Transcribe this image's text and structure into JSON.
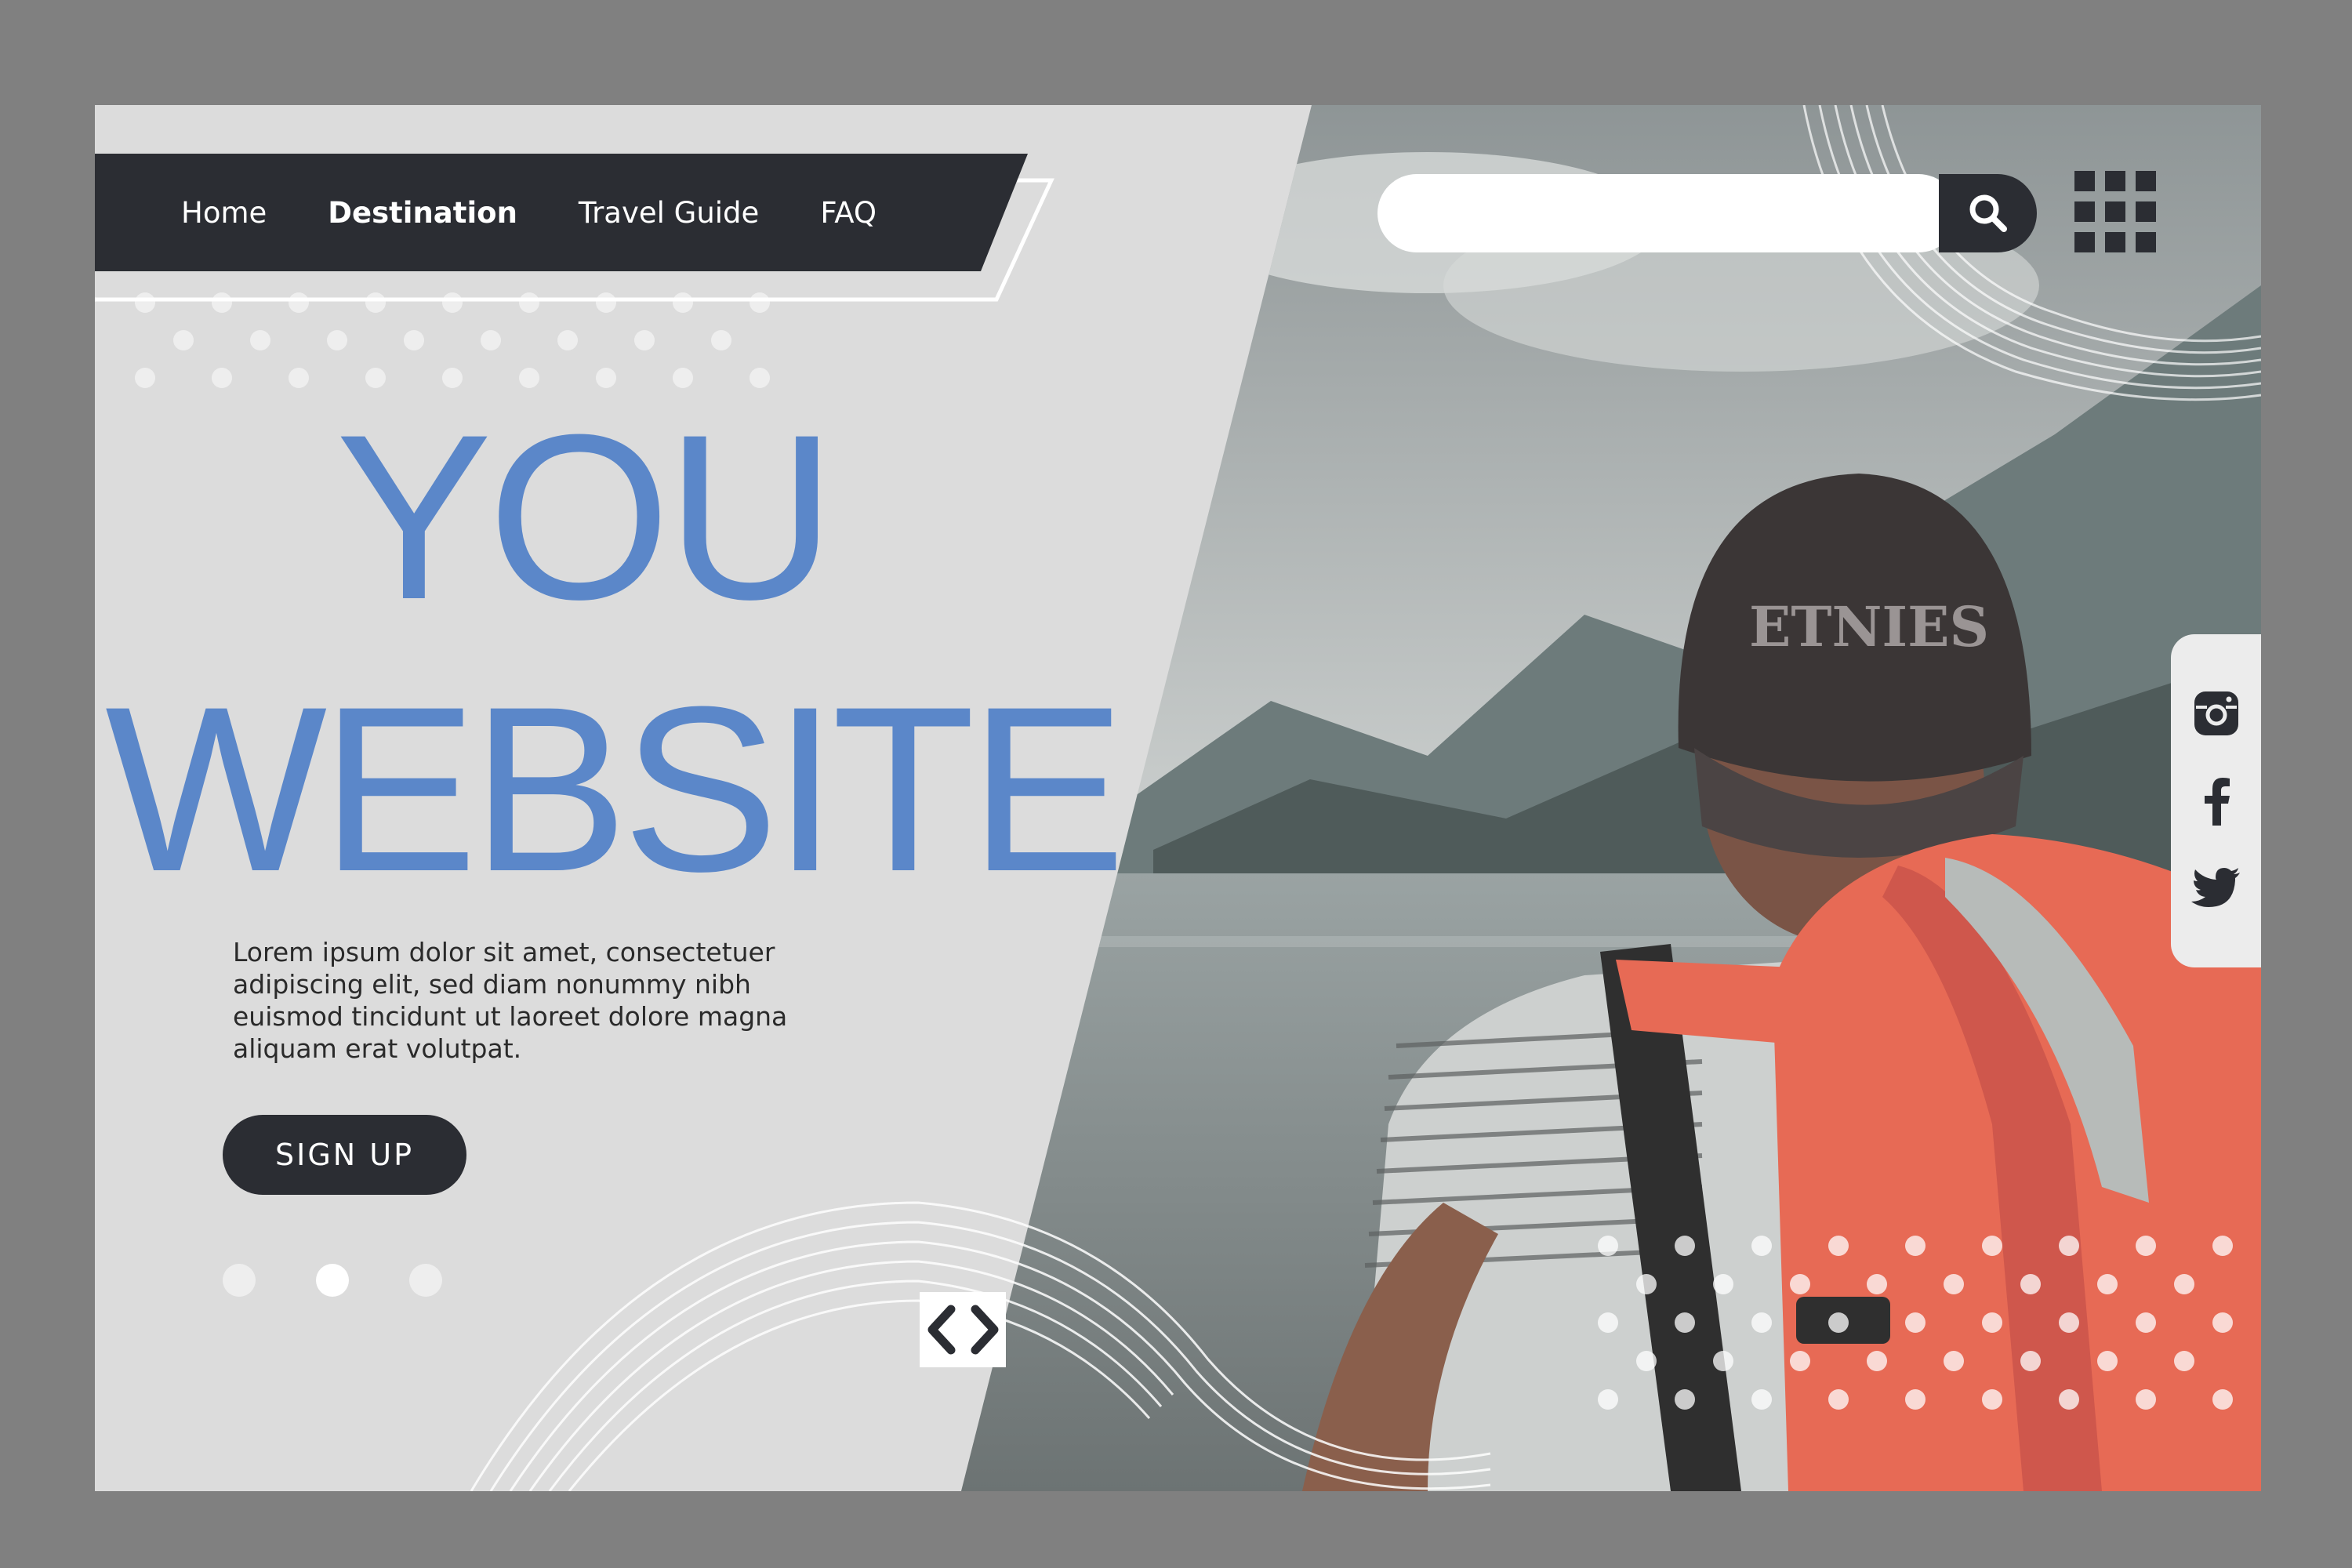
{
  "nav": {
    "items": [
      {
        "label": "Home",
        "active": false
      },
      {
        "label": "Destination",
        "active": true
      },
      {
        "label": "Travel Guide",
        "active": false
      },
      {
        "label": "FAQ",
        "active": false
      }
    ]
  },
  "hero": {
    "headline_line1": "YOU",
    "headline_line2": "WEBSITE",
    "body": "Lorem ipsum dolor sit amet, consectetuer adipiscing elit, sed diam nonummy nibh euismod tincidunt ut laoreet dolore magna aliquam erat volutpat.",
    "cta_label": "SIGN UP"
  },
  "carousel": {
    "dots": 3,
    "active_dot": 2,
    "prev_icon": "chevron-left-icon",
    "next_icon": "chevron-right-icon"
  },
  "search": {
    "placeholder": "",
    "icon": "search-icon"
  },
  "menu": {
    "icon": "grid-menu-icon"
  },
  "social": {
    "icons": [
      "instagram-icon",
      "facebook-icon",
      "twitter-icon"
    ]
  },
  "colors": {
    "background": "#808080",
    "panel": "#dcdcdc",
    "dark": "#2b2d33",
    "headline": "#5b87c9",
    "backpack": "#e76a55"
  }
}
